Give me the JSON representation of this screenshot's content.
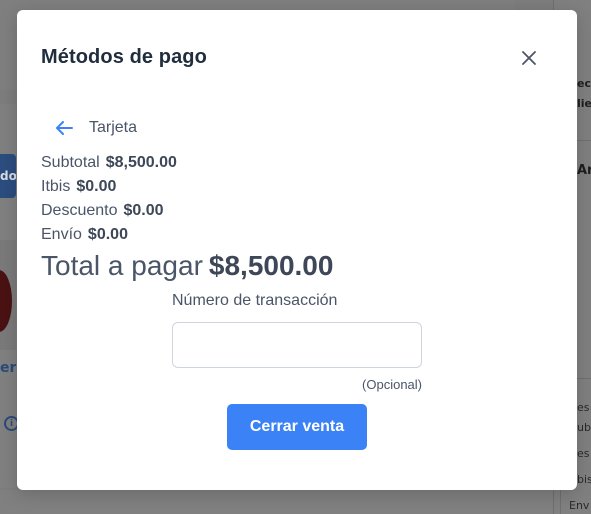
{
  "background": {
    "blue_button_label": "do",
    "link_text": "er",
    "right_texts": [
      "ec",
      "lie",
      "Ar",
      "es",
      "ub",
      "es",
      "bis",
      "Env"
    ]
  },
  "modal": {
    "title": "Métodos de pago",
    "close_icon": "close-icon",
    "back_icon": "arrow-left-icon",
    "back_label": "Tarjeta",
    "summary": [
      {
        "label": "Subtotal",
        "value": "$8,500.00"
      },
      {
        "label": "Itbis",
        "value": "$0.00"
      },
      {
        "label": "Descuento",
        "value": "$0.00"
      },
      {
        "label": "Envío",
        "value": "$0.00"
      }
    ],
    "total": {
      "label": "Total a pagar",
      "value": "$8,500.00"
    },
    "transaction": {
      "label": "Número de transacción",
      "value": "",
      "placeholder": "",
      "hint": "(Opcional)"
    },
    "submit_label": "Cerrar venta"
  },
  "colors": {
    "accent": "#3b82f6",
    "back_arrow": "#3b82f6",
    "overlay": "#7d7d7d",
    "text": "#4a5568"
  }
}
